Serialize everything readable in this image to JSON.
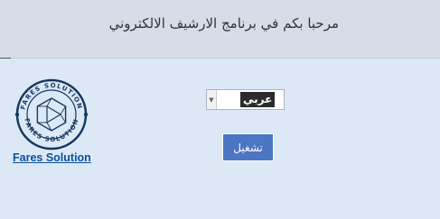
{
  "header": {
    "title": "مرحبا بكم في برنامج الارشيف الالكتروني"
  },
  "logo": {
    "icon": "hexagon-play-logo-icon",
    "ring_text_top": "FARES SOLUTION",
    "ring_text_bottom": "FARES SOLUTION",
    "link_text": "Fares Solution",
    "color": "#15375f"
  },
  "language_select": {
    "selected": "عربي"
  },
  "run_button": {
    "label": "تشغيل",
    "color": "#4b76c4"
  }
}
